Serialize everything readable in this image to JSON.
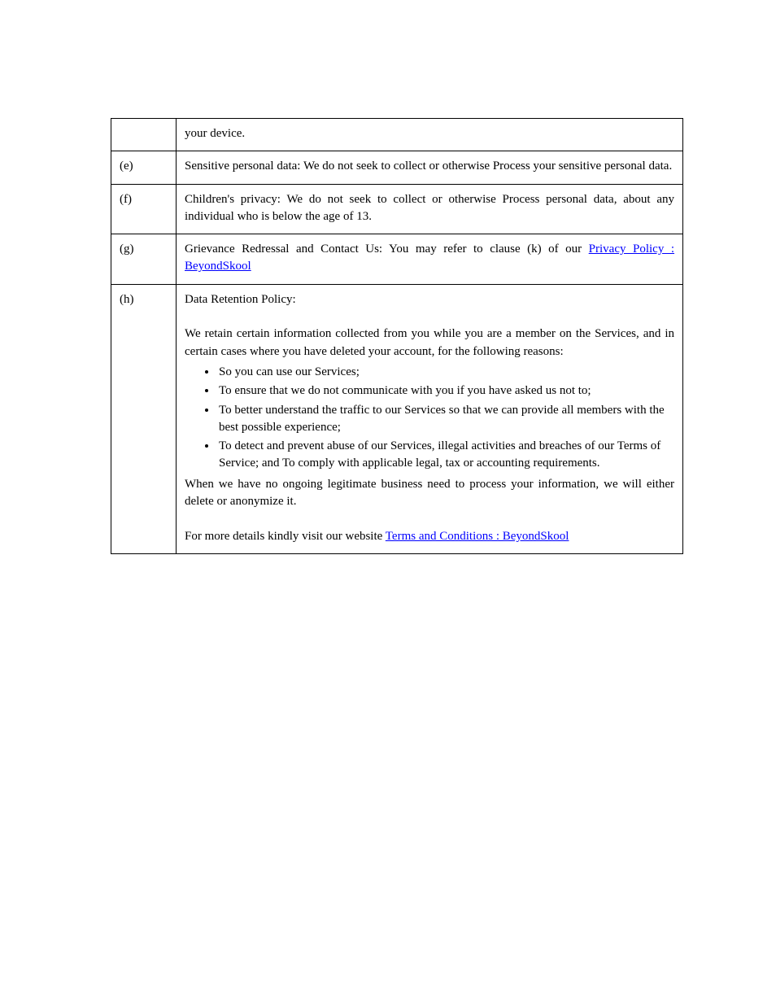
{
  "rows": [
    {
      "label": "",
      "body_html": "your device."
    },
    {
      "label": "(e)",
      "body_html": "Sensitive personal data: We do not seek to collect or otherwise Process your sensitive personal data."
    },
    {
      "label": "(f)",
      "body_html": "Children's privacy: We do not seek to collect or otherwise Process personal data, about any individual who is below the age of 13."
    },
    {
      "label": "(g)",
      "body_html": "Grievance Redressal and Contact Us: You may refer to clause (k) of our <a class=\"link\" href=\"#\" data-name=\"privacy-policy-link\" data-interactable=\"true\">Privacy Policy : BeyondSkool</a>"
    },
    {
      "label": "(h)",
      "body_html": "Data Retention Policy:<br><br>We retain certain information collected from you while you are a member on the Services, and in certain cases where you have deleted your account, for the following reasons:<ul class=\"bullets\"><li data-name=\"list-item\" data-interactable=\"false\">So you can use our Services;</li><li data-name=\"list-item\" data-interactable=\"false\">To ensure that we do not communicate with you if you have asked us not to;</li><li data-name=\"list-item\" data-interactable=\"false\">To better understand the traffic to our Services so that we can provide all members with the best possible experience;</li><li data-name=\"list-item\" data-interactable=\"false\">To detect and prevent abuse of our Services, illegal activities and breaches of our Terms of Service; and To comply with applicable legal, tax or accounting requirements.</li></ul>When we have no ongoing legitimate business need to process your information, we will either delete or anonymize it.<br><br>For more details kindly visit our website <a class=\"link\" href=\"#\" data-name=\"terms-link\" data-interactable=\"true\">Terms and Conditions : BeyondSkool</a>"
    }
  ]
}
